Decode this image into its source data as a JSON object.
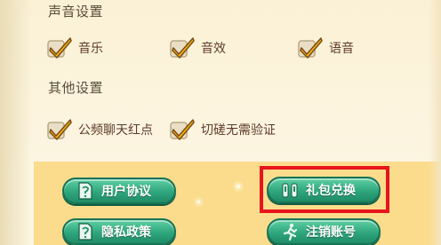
{
  "sound_settings": {
    "heading": "声音设置",
    "options": [
      {
        "label": "音乐",
        "checked": true
      },
      {
        "label": "音效",
        "checked": true
      },
      {
        "label": "语音",
        "checked": true
      }
    ]
  },
  "other_settings": {
    "heading": "其他设置",
    "options": [
      {
        "label": "公频聊天红点",
        "checked": true
      },
      {
        "label": "切磋无需验证",
        "checked": true
      }
    ]
  },
  "buttons": {
    "user_agreement": {
      "label": "用户协议",
      "icon": "document-icon"
    },
    "gift_redeem": {
      "label": "礼包兑换",
      "icon": "gift-icon"
    },
    "privacy_policy": {
      "label": "隐私政策",
      "icon": "document-icon"
    },
    "cancel_account": {
      "label": "注销账号",
      "icon": "running-figure-icon"
    }
  },
  "colors": {
    "button_green": "#2fa67d",
    "highlight_red": "#e8141c",
    "check_yellow": "#f5b21e",
    "panel_footer": "#fbdc8c"
  }
}
